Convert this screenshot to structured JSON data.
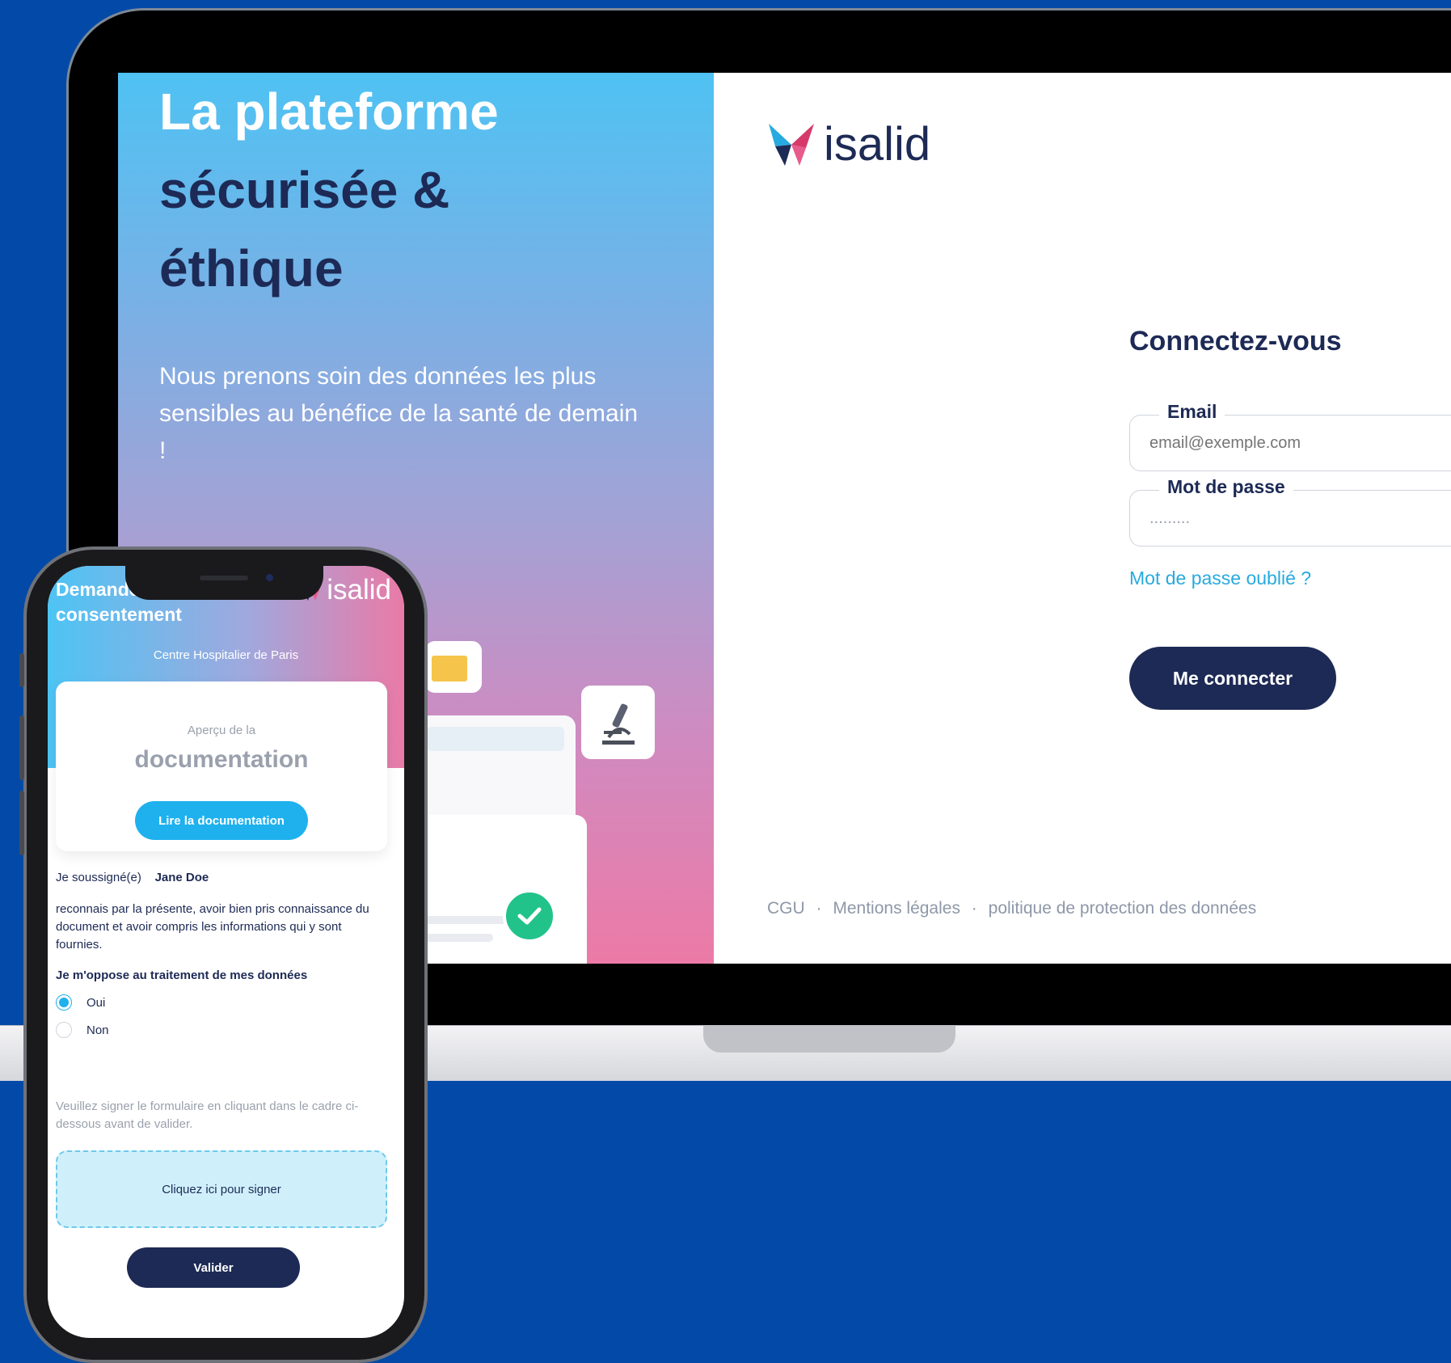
{
  "promo": {
    "title_line1": "La plateforme",
    "title_line2": "sécurisée &",
    "title_line3": "éthique",
    "subtitle": "Nous prenons soin des données les plus sensibles au bénéfice de la santé de demain !"
  },
  "login": {
    "logo_text": "isalid",
    "title": "Connectez-vous",
    "email_label": "Email",
    "email_placeholder": "email@exemple.com",
    "password_label": "Mot de passe",
    "password_value": ".........",
    "forgot_link": "Mot de passe oublié ?",
    "submit_label": "Me connecter",
    "footer": {
      "cgu": "CGU",
      "mentions": "Mentions légales",
      "privacy": "politique de protection des données",
      "separator": "·"
    }
  },
  "phone": {
    "title": "Demande de consentement",
    "logo_text": "isalid",
    "hospital": "Centre Hospitalier de Paris",
    "card_small": "Aperçu de la",
    "card_big": "documentation",
    "read_button": "Lire la documentation",
    "undersigned_label": "Je soussigné(e)",
    "undersigned_name": "Jane Doe",
    "acknowledgement": "reconnais par la présente, avoir bien pris connaissance du document et avoir compris les informations qui y sont fournies.",
    "question": "Je m'oppose au traitement de mes données",
    "options": [
      "Oui",
      "Non"
    ],
    "selected_option": "Oui",
    "sign_hint": "Veuillez signer le formulaire en cliquant dans le cadre ci-dessous avant de valider.",
    "sign_box": "Cliquez ici pour signer",
    "validate_button": "Valider"
  },
  "colors": {
    "background": "#034aa8",
    "navy": "#1d2a55",
    "accent_blue": "#1eb1ee",
    "link_blue": "#27aadf",
    "gradient_top": "#4fc2f3",
    "gradient_bottom": "#ec7aa6",
    "success_green": "#22c38a"
  }
}
